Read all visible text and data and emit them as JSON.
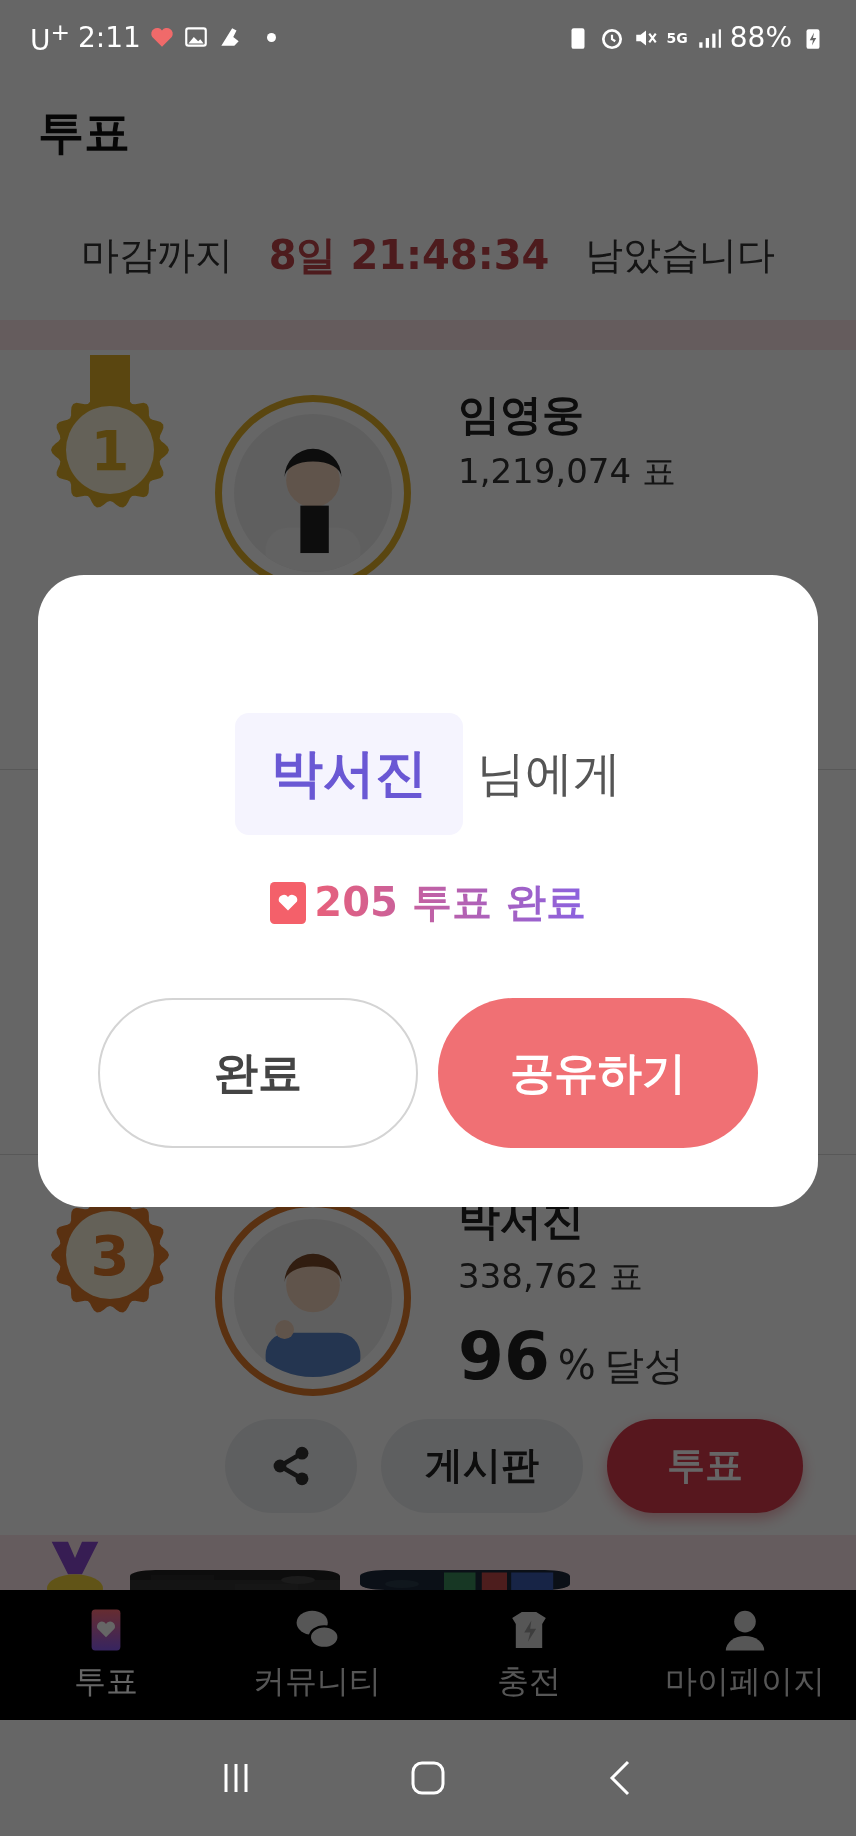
{
  "status_bar": {
    "carrier": "U$^{+}$",
    "time": "2:11",
    "network": "5G",
    "battery": "88%"
  },
  "header": {
    "title": "투표"
  },
  "countdown": {
    "prefix": "마감까지",
    "time": "8일 21:48:34",
    "suffix": "남았습니다"
  },
  "ranking": [
    {
      "rank": "1",
      "name": "임영웅",
      "votes": "1,219,074 표",
      "kind": "gold"
    },
    {
      "rank": "3",
      "name": "박서진",
      "votes": "338,762 표",
      "percent": "96",
      "percent_unit": "%",
      "achieved": "달성",
      "board": "게시판",
      "vote": "투표",
      "kind": "bronze"
    }
  ],
  "dialog": {
    "recipient": "박서진",
    "recipient_suffix": "님에게",
    "result": "205 투표 완료",
    "buttons": [
      {
        "label": "완료",
        "kind": "secondary"
      },
      {
        "label": "공유하기",
        "kind": "primary"
      }
    ]
  },
  "bottom_nav": [
    {
      "label": "투표",
      "selected": true,
      "kind": "vote"
    },
    {
      "label": "커뮤니티",
      "selected": false,
      "kind": "community"
    },
    {
      "label": "충전",
      "selected": false,
      "kind": "charge"
    },
    {
      "label": "마이페이지",
      "selected": false,
      "kind": "mypage"
    }
  ]
}
